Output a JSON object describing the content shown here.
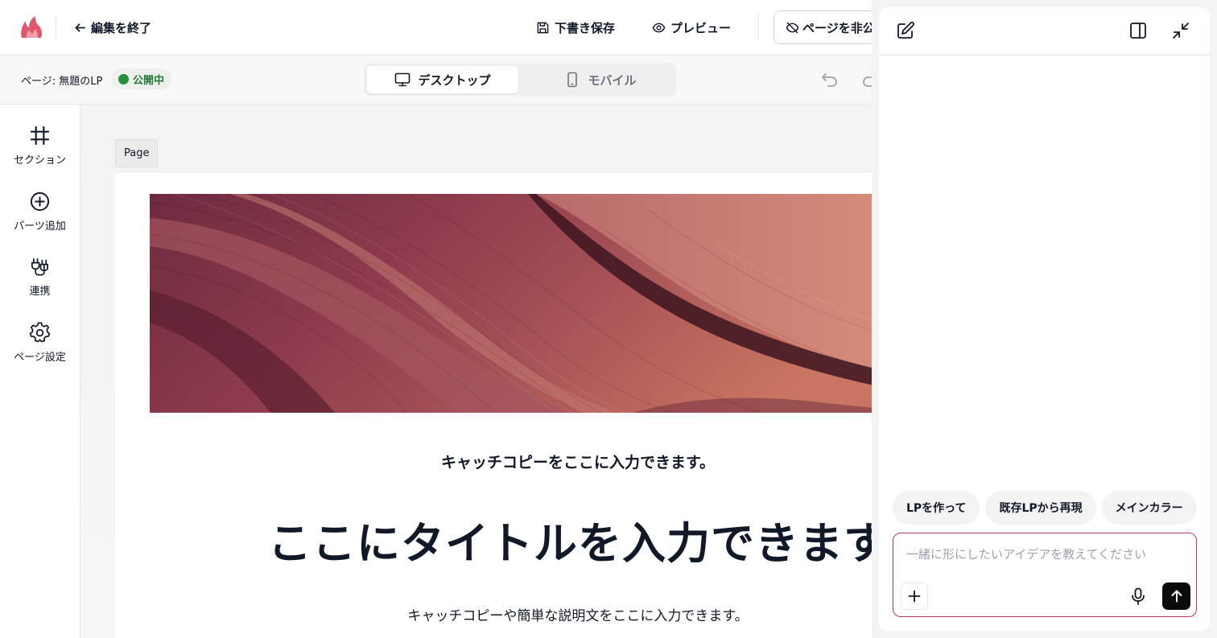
{
  "header": {
    "exit_label": "編集を終了",
    "save_draft_label": "下書き保存",
    "preview_label": "プレビュー",
    "hide_page_label": "ページを非公開"
  },
  "subbar": {
    "page_label": "ページ: 無題のLP",
    "status": "公開中",
    "device_desktop": "デスクトップ",
    "device_mobile": "モバイル"
  },
  "sidebar": {
    "items": [
      {
        "label": "セクション",
        "icon": "hash-icon"
      },
      {
        "label": "パーツ追加",
        "icon": "plus-circle-icon"
      },
      {
        "label": "連携",
        "icon": "plug-icon"
      },
      {
        "label": "ページ設定",
        "icon": "gear-icon"
      }
    ]
  },
  "canvas": {
    "page_tag": "Page",
    "catch_copy": "キャッチコピーをここに入力できます。",
    "title": "ここにタイトルを入力できます",
    "description": "キャッチコピーや簡単な説明文をここに入力できます。"
  },
  "chat": {
    "chips": [
      "LPを作って",
      "既存LPから再現",
      "メインカラー"
    ],
    "input_placeholder": "一緒に形にしたいアイデアを教えてください"
  },
  "colors": {
    "status_green": "#22913c",
    "composer_border": "#b83a5b",
    "logo_red": "#e2566b"
  }
}
